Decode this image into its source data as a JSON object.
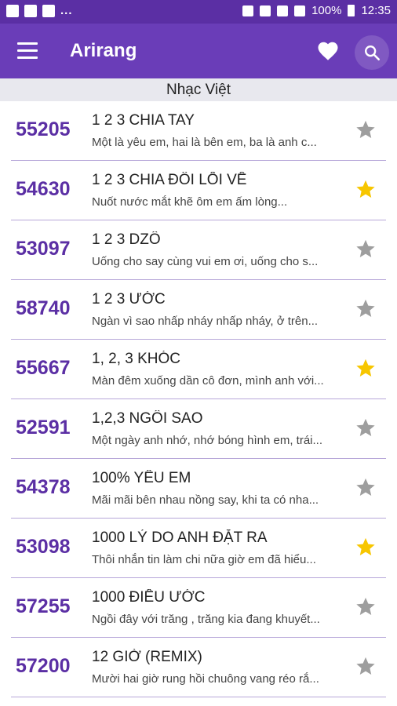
{
  "statusbar": {
    "dots": "...",
    "battery": "100%",
    "time": "12:35"
  },
  "appbar": {
    "title": "Arirang"
  },
  "section": {
    "title": "Nhạc Việt"
  },
  "colors": {
    "accent": "#5b2fa4",
    "appbar": "#6a3db8",
    "star_on": "#f7c600",
    "star_off": "#9e9e9e"
  },
  "songs": [
    {
      "code": "55205",
      "title": "1 2 3 CHIA TAY",
      "lyric": "Một là yêu em, hai là bên em, ba là anh c...",
      "favorite": false
    },
    {
      "code": "54630",
      "title": "1 2 3 CHIA ĐÔI LỐI VỀ",
      "lyric": "Nuốt nước mắt khẽ ôm em ấm lòng...",
      "favorite": true
    },
    {
      "code": "53097",
      "title": "1 2 3 DZÔ",
      "lyric": "Uống cho say cùng vui em ơi, uống cho s...",
      "favorite": false
    },
    {
      "code": "58740",
      "title": "1 2 3 ƯỚC",
      "lyric": "Ngàn vì sao nhấp nháy nhấp nháy, ở trên...",
      "favorite": false
    },
    {
      "code": "55667",
      "title": "1, 2, 3 KHÓC",
      "lyric": "Màn đêm xuống dần cô đơn, mình anh với...",
      "favorite": true
    },
    {
      "code": "52591",
      "title": "1,2,3 NGÔI SAO",
      "lyric": "Một ngày anh nhớ, nhớ bóng hình em, trái...",
      "favorite": false
    },
    {
      "code": "54378",
      "title": "100% YÊU EM",
      "lyric": "Mãi mãi bên nhau nồng say, khi ta có nha...",
      "favorite": false
    },
    {
      "code": "53098",
      "title": "1000 LÝ DO ANH ĐẶT RA",
      "lyric": "Thôi nhắn tin làm chi nữa giờ em đã hiểu...",
      "favorite": true
    },
    {
      "code": "57255",
      "title": "1000 ĐIỀU ƯỚC",
      "lyric": "Ngồi đây với trăng , trăng kia đang khuyết...",
      "favorite": false
    },
    {
      "code": "57200",
      "title": "12 GIỜ (REMIX)",
      "lyric": "Mười hai giờ rung hồi chuông vang réo rắ...",
      "favorite": false
    }
  ]
}
